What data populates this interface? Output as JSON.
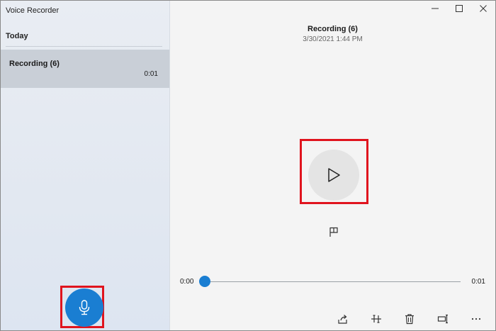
{
  "app": {
    "title": "Voice Recorder"
  },
  "sidebar": {
    "group_label": "Today",
    "recordings": [
      {
        "name": "Recording (6)",
        "duration": "0:01",
        "selected": true
      }
    ]
  },
  "recording": {
    "title": "Recording (6)",
    "date": "3/30/2021 1:44 PM"
  },
  "playback": {
    "current_time": "0:00",
    "total_time": "0:01",
    "progress_fraction": 0
  },
  "icons": {
    "minimize": "minimize-icon",
    "maximize": "maximize-icon",
    "close": "close-icon",
    "play": "play-icon",
    "flag": "flag-icon",
    "microphone": "microphone-icon",
    "share": "share-icon",
    "trim": "trim-icon",
    "delete": "trash-icon",
    "rename": "rename-icon",
    "more": "more-icon"
  },
  "colors": {
    "accent": "#1a7ed2",
    "highlight": "#e0141e",
    "selected_item": "#c9cfd7"
  }
}
